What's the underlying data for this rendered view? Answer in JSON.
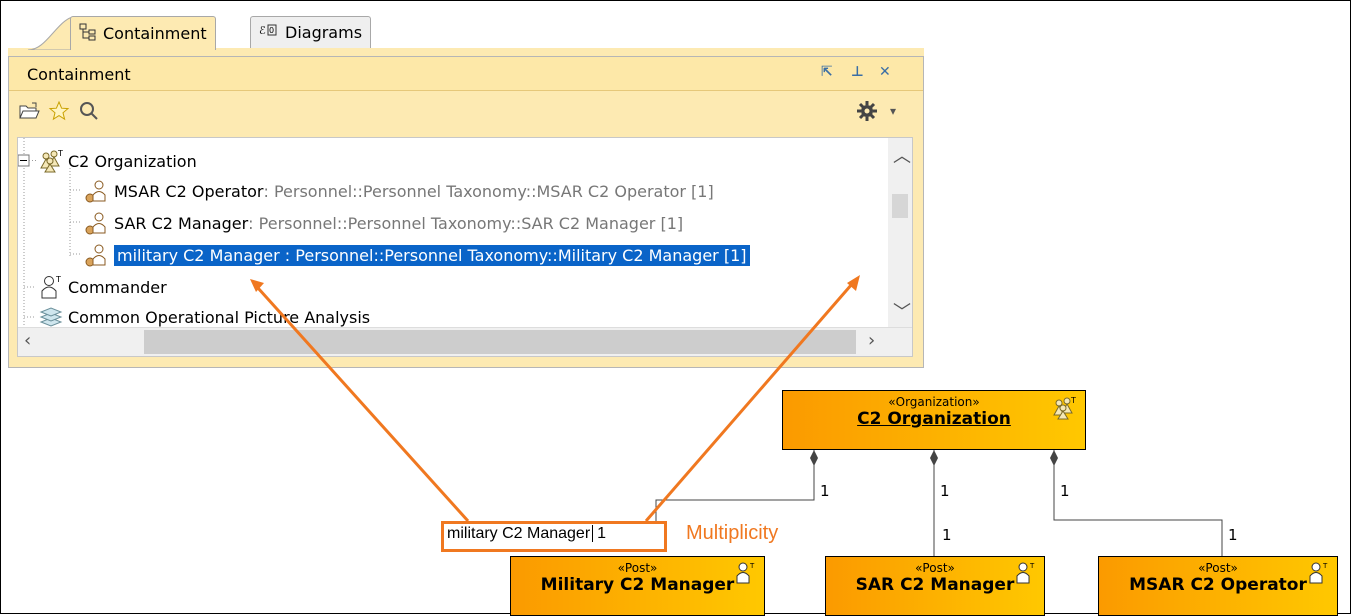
{
  "tabs": [
    {
      "label": "Containment",
      "icon": "containment-tree-icon",
      "active": true
    },
    {
      "label": "Diagrams",
      "icon": "diagrams-icon",
      "active": false
    }
  ],
  "panel": {
    "title": "Containment",
    "controls": [
      "detach-icon",
      "pin-icon",
      "close-icon"
    ]
  },
  "toolbar": [
    "open-folder-icon",
    "star-icon",
    "search-icon",
    "gear-icon",
    "dropdown-arrow-icon"
  ],
  "tree": {
    "rows": [
      {
        "name": "C2 Organization",
        "type": "",
        "icon": "organization-icon"
      },
      {
        "name": "MSAR C2 Operator",
        "type": " : Personnel::Personnel Taxonomy::MSAR C2 Operator [1]",
        "icon": "post-part-icon"
      },
      {
        "name": "SAR C2 Manager",
        "type": " : Personnel::Personnel Taxonomy::SAR C2 Manager [1]",
        "icon": "post-part-icon"
      },
      {
        "name": "military C2 Manager : Personnel::Personnel Taxonomy::Military C2 Manager [1]",
        "type": "",
        "icon": "post-part-icon",
        "selected": true
      },
      {
        "name": "Commander",
        "type": "",
        "icon": "post-icon"
      },
      {
        "name": "Common Operational Picture Analysis",
        "type": "",
        "icon": "analysis-icon"
      }
    ]
  },
  "diagram": {
    "organization": {
      "stereotype": "«Organization»",
      "name": "C2 Organization"
    },
    "posts": [
      {
        "stereotype": "«Post»",
        "name": "Military C2 Manager"
      },
      {
        "stereotype": "«Post»",
        "name": "SAR C2 Manager"
      },
      {
        "stereotype": "«Post»",
        "name": "MSAR C2 Operator"
      }
    ],
    "multiplicities": [
      "1",
      "1",
      "1",
      "1",
      "1",
      "1"
    ],
    "role_label": "military C2 Manager",
    "role_multiplicity": "1",
    "annotation": "Multiplicity"
  },
  "colors": {
    "accent": "#f07820",
    "selection": "#0a64c8",
    "panel": "#fdeab2"
  }
}
